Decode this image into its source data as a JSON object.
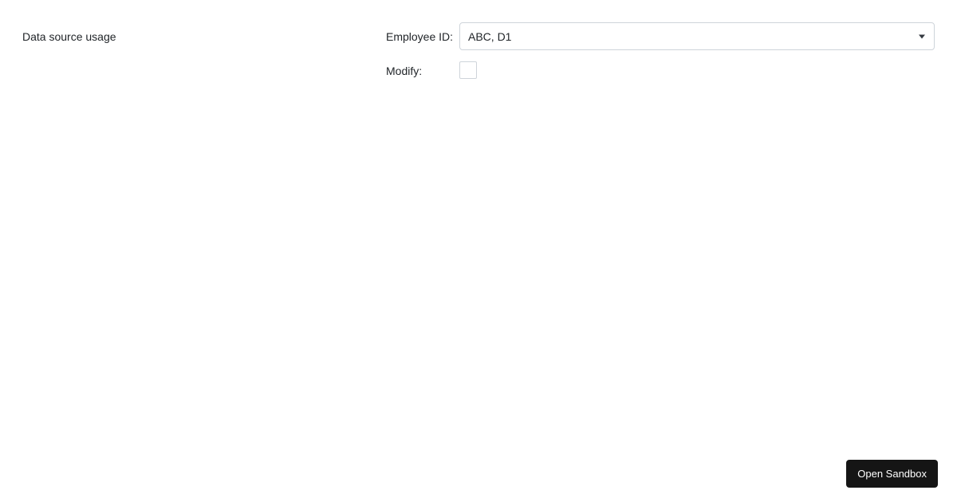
{
  "title": "Data source usage",
  "form": {
    "employee_id": {
      "label": "Employee ID:",
      "value": "ABC, D1"
    },
    "modify": {
      "label": "Modify:",
      "checked": false
    }
  },
  "footer": {
    "open_sandbox": "Open Sandbox"
  }
}
